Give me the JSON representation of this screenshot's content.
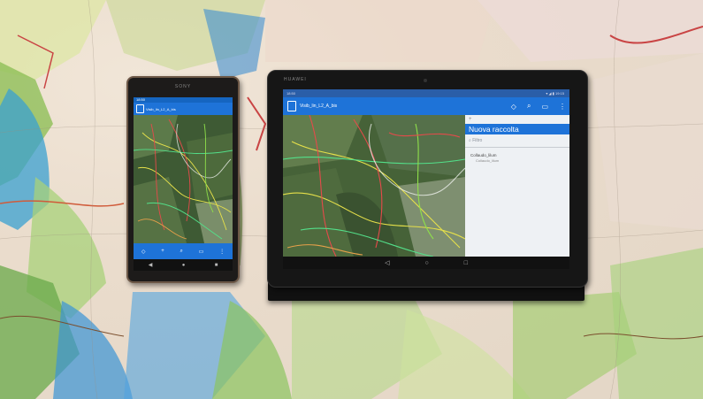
{
  "phone": {
    "brand": "SONY",
    "status_time": "18:50",
    "app_title": "Visib_lin_L2_A_bis",
    "bottom_icons": [
      "diamond-icon",
      "plus-icon",
      "search-icon",
      "layers-icon",
      "more-icon"
    ]
  },
  "tablet": {
    "brand": "HUAWEI",
    "status_left": "18:50",
    "status_right": "▾ ◢ ▮ 19:15",
    "app_title": "Visib_lin_L2_A_bis",
    "panel": {
      "new_collection": "Nuova raccolta",
      "filter_placeholder": "Filtro",
      "items": [
        {
          "title": "Collaudo_lilum",
          "subtitle": "Collaudo_lilum"
        }
      ]
    }
  },
  "colors": {
    "app_blue": "#1e73d8",
    "map_bg": "#eadccc"
  }
}
